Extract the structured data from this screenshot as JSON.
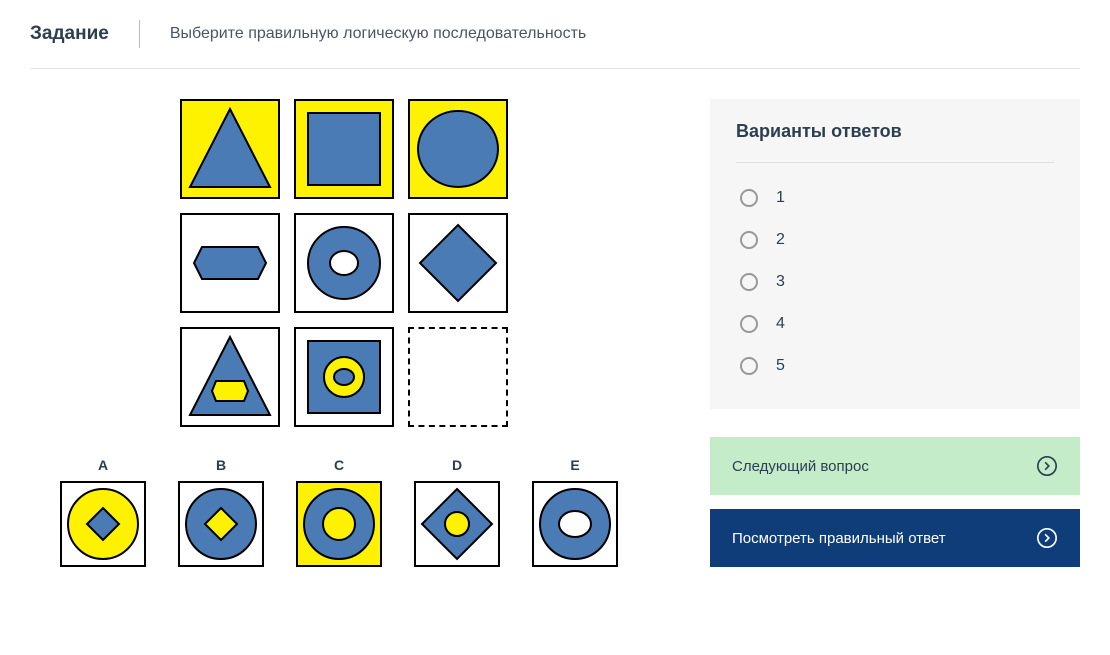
{
  "header": {
    "title": "Задание",
    "instruction": "Выберите правильную логическую последовательность"
  },
  "colors": {
    "blue": "#4a7bb5",
    "blueDark": "#2d5a8f",
    "yellow": "#fff200"
  },
  "grid": [
    {
      "bg": "yellow",
      "shape": "triangle",
      "fill": "blue"
    },
    {
      "bg": "yellow",
      "shape": "square",
      "fill": "blue"
    },
    {
      "bg": "yellow",
      "shape": "circle",
      "fill": "blue"
    },
    {
      "bg": "white",
      "shape": "hexagon",
      "fill": "blue"
    },
    {
      "bg": "white",
      "shape": "ring",
      "fill": "blue"
    },
    {
      "bg": "white",
      "shape": "diamond",
      "fill": "blue"
    },
    {
      "bg": "white",
      "shape": "triangle-hex",
      "fill": "blue"
    },
    {
      "bg": "white",
      "shape": "square-ring",
      "fill": "blue"
    },
    {
      "bg": "missing"
    }
  ],
  "options": [
    {
      "label": "A",
      "bg": "white",
      "variant": "a"
    },
    {
      "label": "B",
      "bg": "white",
      "variant": "b"
    },
    {
      "label": "C",
      "bg": "yellow",
      "variant": "c"
    },
    {
      "label": "D",
      "bg": "white",
      "variant": "d"
    },
    {
      "label": "E",
      "bg": "white",
      "variant": "e"
    }
  ],
  "answers": {
    "title": "Варианты ответов",
    "items": [
      "1",
      "2",
      "3",
      "4",
      "5"
    ]
  },
  "buttons": {
    "next": "Следующий вопрос",
    "show_answer": "Посмотреть правильный ответ"
  }
}
